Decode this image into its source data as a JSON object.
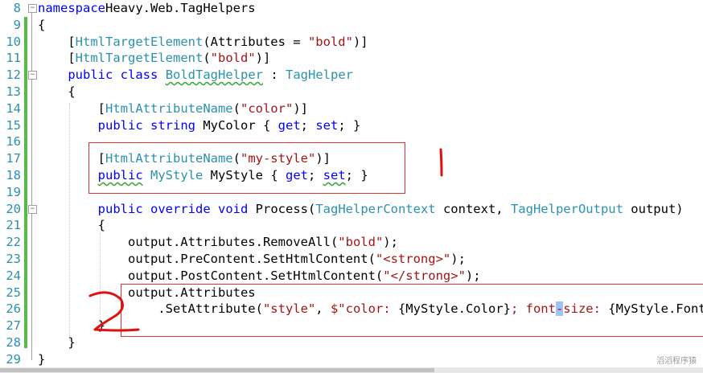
{
  "lines": [
    {
      "num": "8",
      "parts": [
        [
          "k",
          "namespace"
        ],
        [
          "",
          "Heavy.Web.TagHelpers"
        ]
      ]
    },
    {
      "num": "9",
      "parts": [
        [
          "",
          "{"
        ]
      ]
    },
    {
      "num": "10",
      "parts": [
        [
          "",
          "    ["
        ],
        [
          "t",
          "HtmlTargetElement"
        ],
        [
          "",
          "(Attributes = "
        ],
        [
          "s",
          "\"bold\""
        ],
        [
          "",
          ")]"
        ]
      ]
    },
    {
      "num": "11",
      "parts": [
        [
          "",
          "    ["
        ],
        [
          "t",
          "HtmlTargetElement"
        ],
        [
          "",
          "("
        ],
        [
          "s",
          "\"bold\""
        ],
        [
          "",
          ")]"
        ]
      ]
    },
    {
      "num": "12",
      "parts": [
        [
          "",
          "    "
        ],
        [
          "k",
          "public"
        ],
        [
          "",
          " "
        ],
        [
          "k",
          "class"
        ],
        [
          "",
          " "
        ],
        [
          "t sq",
          "BoldTagHelper"
        ],
        [
          "",
          " : "
        ],
        [
          "t",
          "TagHelper"
        ]
      ]
    },
    {
      "num": "13",
      "parts": [
        [
          "",
          "    {"
        ]
      ]
    },
    {
      "num": "14",
      "parts": [
        [
          "",
          "        ["
        ],
        [
          "t",
          "HtmlAttributeName"
        ],
        [
          "",
          "("
        ],
        [
          "s",
          "\"color\""
        ],
        [
          "",
          ")]"
        ]
      ]
    },
    {
      "num": "15",
      "parts": [
        [
          "",
          "        "
        ],
        [
          "k",
          "public"
        ],
        [
          "",
          " "
        ],
        [
          "k",
          "string"
        ],
        [
          "",
          " MyColor { "
        ],
        [
          "k",
          "get"
        ],
        [
          "",
          "; "
        ],
        [
          "k",
          "set"
        ],
        [
          "",
          "; }"
        ]
      ]
    },
    {
      "num": "16",
      "parts": []
    },
    {
      "num": "17",
      "parts": [
        [
          "",
          "        ["
        ],
        [
          "t",
          "HtmlAttributeName"
        ],
        [
          "",
          "("
        ],
        [
          "s",
          "\"my-style\""
        ],
        [
          "",
          ")]"
        ]
      ]
    },
    {
      "num": "18",
      "parts": [
        [
          "",
          "        "
        ],
        [
          "k sq",
          "public"
        ],
        [
          "",
          " "
        ],
        [
          "t",
          "MyStyle"
        ],
        [
          "",
          " MyStyle { "
        ],
        [
          "k",
          "get"
        ],
        [
          "",
          "; "
        ],
        [
          "k sq",
          "set"
        ],
        [
          "",
          "; }"
        ]
      ]
    },
    {
      "num": "19",
      "parts": []
    },
    {
      "num": "20",
      "parts": [
        [
          "",
          "        "
        ],
        [
          "k",
          "public"
        ],
        [
          "",
          " "
        ],
        [
          "k",
          "override"
        ],
        [
          "",
          " "
        ],
        [
          "k",
          "void"
        ],
        [
          "",
          " Process("
        ],
        [
          "t",
          "TagHelperContext"
        ],
        [
          "",
          " context, "
        ],
        [
          "t",
          "TagHelperOutput"
        ],
        [
          "",
          " output)"
        ]
      ]
    },
    {
      "num": "21",
      "parts": [
        [
          "",
          "        {"
        ]
      ]
    },
    {
      "num": "22",
      "parts": [
        [
          "",
          "            output.Attributes.RemoveAll("
        ],
        [
          "s",
          "\"bold\""
        ],
        [
          "",
          ");"
        ]
      ]
    },
    {
      "num": "23",
      "parts": [
        [
          "",
          "            output.PreContent.SetHtmlContent("
        ],
        [
          "s",
          "\"<strong>\""
        ],
        [
          "",
          ");"
        ]
      ]
    },
    {
      "num": "24",
      "parts": [
        [
          "",
          "            output.PostContent.SetHtmlContent("
        ],
        [
          "s",
          "\"</strong>\""
        ],
        [
          "",
          ");"
        ]
      ]
    },
    {
      "num": "25",
      "parts": [
        [
          "",
          "            output.Attributes"
        ]
      ]
    },
    {
      "num": "26",
      "parts": [
        [
          "",
          "                .SetAttribute("
        ],
        [
          "s",
          "\"style\""
        ],
        [
          "",
          ", "
        ],
        [
          "s",
          "$\"color: "
        ],
        [
          "",
          "{MyStyle.Color}"
        ],
        [
          "s",
          "; font"
        ],
        [
          "s cursor-hl",
          "-"
        ],
        [
          "s",
          "size: "
        ],
        [
          "",
          "{MyStyle.Font"
        ]
      ]
    },
    {
      "num": "27",
      "parts": [
        [
          "",
          "        }"
        ]
      ]
    },
    {
      "num": "28",
      "parts": [
        [
          "",
          "    }"
        ]
      ]
    },
    {
      "num": "29",
      "parts": [
        [
          "",
          "}"
        ]
      ]
    }
  ],
  "watermark": "滔滔程序猿",
  "colors": {
    "keyword": "#0000ff",
    "type": "#2b91af",
    "string": "#a31515",
    "line_number": "#2b91af",
    "change_bar": "#57b947",
    "annotation": "#d93333"
  }
}
